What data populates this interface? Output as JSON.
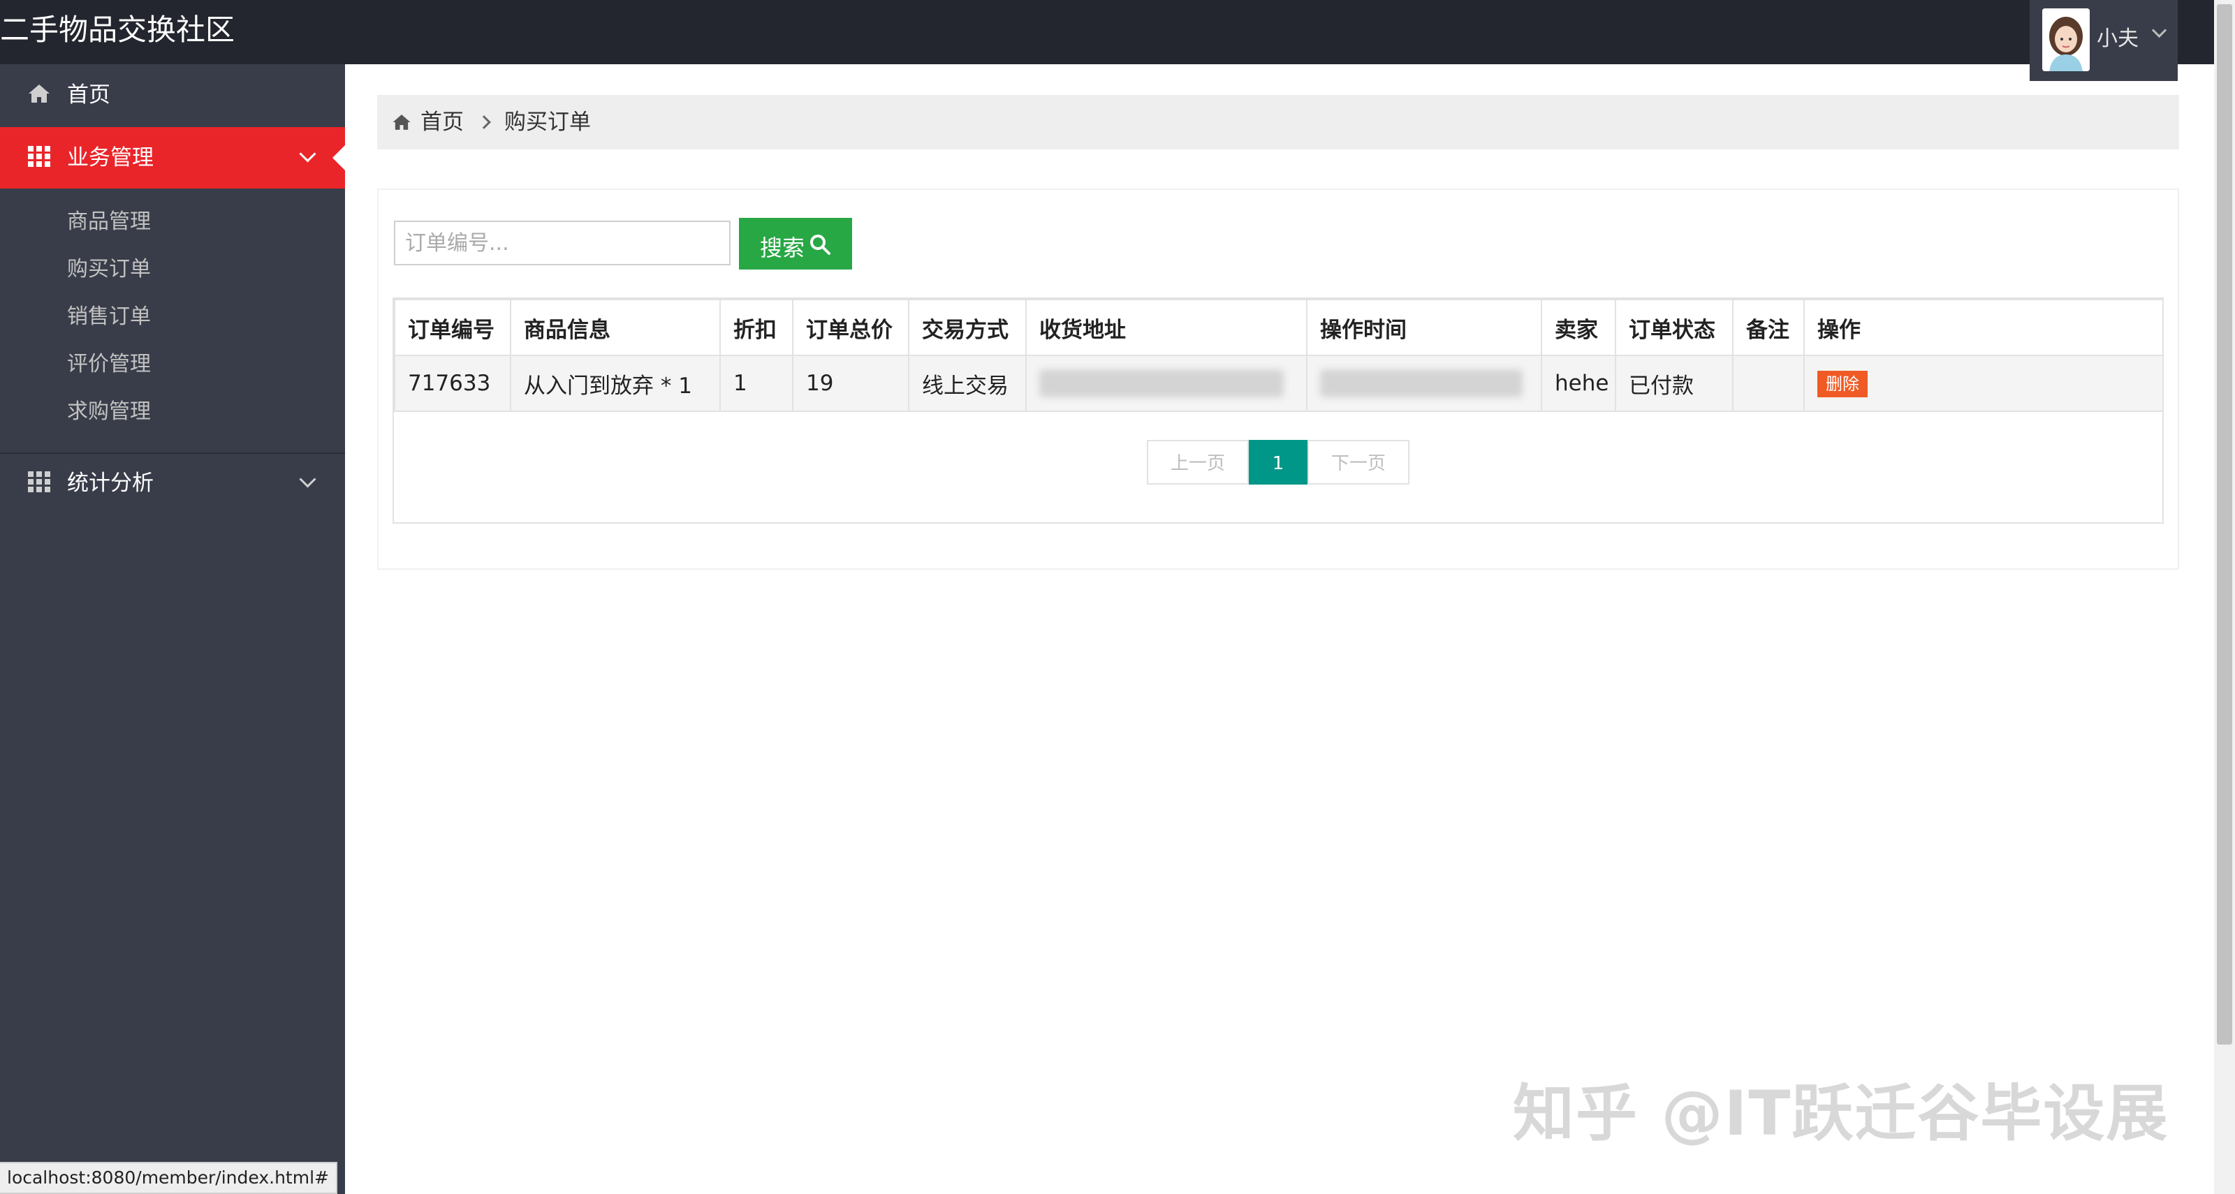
{
  "header": {
    "app_title": "二手物品交换社区",
    "user_name": "小夫"
  },
  "sidebar": {
    "home_label": "首页",
    "business_label": "业务管理",
    "sub_items": [
      "商品管理",
      "购买订单",
      "销售订单",
      "评价管理",
      "求购管理"
    ],
    "stats_label": "统计分析"
  },
  "breadcrumb": {
    "home": "首页",
    "current": "购买订单"
  },
  "search": {
    "placeholder": "订单编号...",
    "button_label": "搜索"
  },
  "table": {
    "columns": [
      "订单编号",
      "商品信息",
      "折扣",
      "订单总价",
      "交易方式",
      "收货地址",
      "操作时间",
      "卖家",
      "订单状态",
      "备注",
      "操作"
    ],
    "rows": [
      {
        "order_no": "717633",
        "product": "从入门到放弃 * 1",
        "discount": "1",
        "total": "19",
        "trade_method": "线上交易",
        "seller": "hehe",
        "status": "已付款",
        "remark": "",
        "action_label": "删除"
      }
    ]
  },
  "pagination": {
    "prev": "上一页",
    "current": "1",
    "next": "下一页"
  },
  "status_bar": "localhost:8080/member/index.html#",
  "watermark": "知乎 @IT跃迁谷毕设展",
  "colors": {
    "header_bg": "#23262e",
    "sidebar_bg": "#393d49",
    "active_nav": "#e9252a",
    "search_button": "#28a745",
    "page_current": "#009688",
    "delete_button": "#f05a24"
  }
}
